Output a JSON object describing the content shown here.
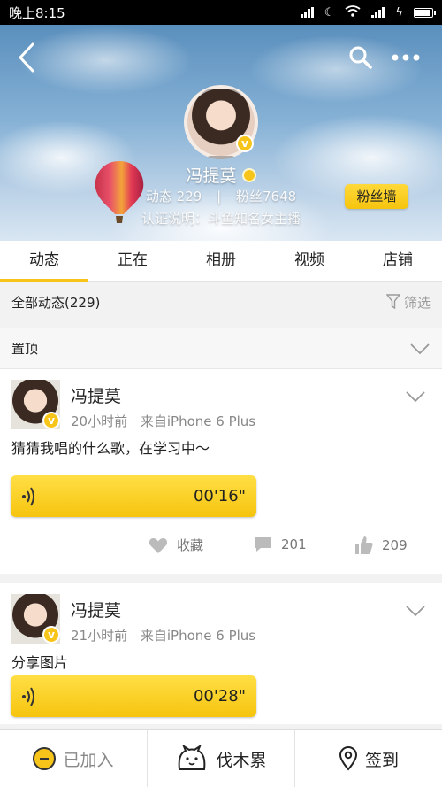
{
  "status_bar": {
    "time": "晚上8:15"
  },
  "header": {
    "name": "冯提莫",
    "stats": {
      "dongtai_label": "动态",
      "dongtai_count": "229",
      "fans_label": "粉丝",
      "fans_count": "7648"
    },
    "certification": "认证说明：斗鱼知名女主播",
    "fan_wall_label": "粉丝墙"
  },
  "tabs": [
    {
      "label": "动态",
      "active": true
    },
    {
      "label": "正在"
    },
    {
      "label": "相册"
    },
    {
      "label": "视频"
    },
    {
      "label": "店铺"
    }
  ],
  "filter": {
    "all_label": "全部动态(229)",
    "filter_label": "筛选"
  },
  "pinned": {
    "label": "置顶"
  },
  "posts": [
    {
      "author": "冯提莫",
      "time": "20小时前",
      "source": "来自iPhone 6 Plus",
      "text": "猜猜我唱的什么歌，在学习中～",
      "voice_duration": "00'16\"",
      "favorite_label": "收藏",
      "comments": "201",
      "likes": "209"
    },
    {
      "author": "冯提莫",
      "time": "21小时前",
      "source": "来自iPhone 6 Plus",
      "text": "分享图片",
      "voice_duration": "00'28\""
    }
  ],
  "bottom_bar": {
    "joined_label": "已加入",
    "group_label": "伐木累",
    "checkin_label": "签到"
  },
  "colors": {
    "accent": "#f7c51a",
    "text": "#222222",
    "muted": "#888888"
  }
}
